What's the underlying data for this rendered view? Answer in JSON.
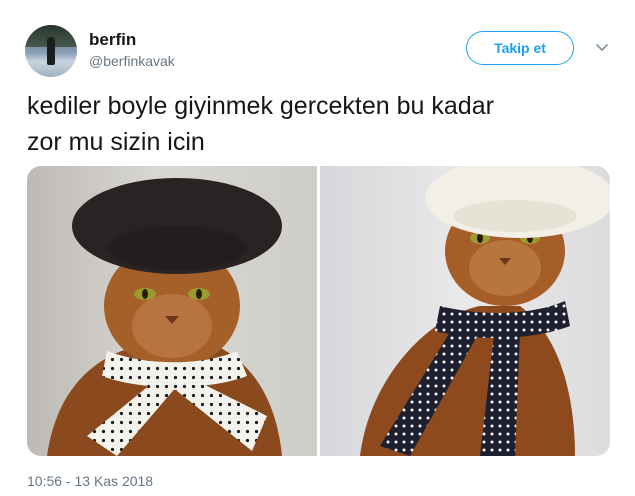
{
  "tweet": {
    "author": {
      "display_name": "berfin",
      "handle": "@berfinkavak"
    },
    "follow_button": "Takip et",
    "text_lines": [
      "kediler boyle giyinmek gercekten bu kadar",
      "zor mu sizin icin"
    ],
    "media": [
      {
        "description_icon": "cat-black-beret-photo"
      },
      {
        "description_icon": "cat-white-beret-photo"
      }
    ],
    "timestamp": "10:56 - 13 Kas 2018"
  },
  "colors": {
    "accent": "#1da1f2",
    "text": "#14171a",
    "secondary_text": "#657786"
  }
}
